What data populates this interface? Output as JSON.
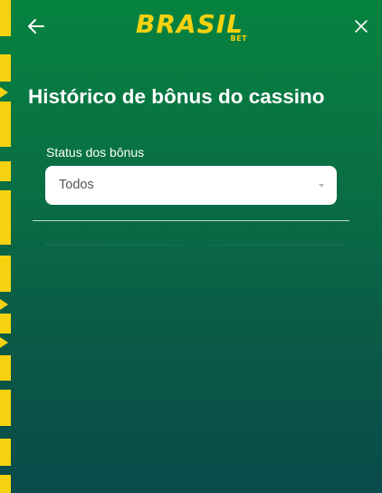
{
  "header": {
    "logo_main": "BRASIL",
    "logo_sub": "BET",
    "back_icon": "arrow-left-icon",
    "close_icon": "close-icon"
  },
  "page": {
    "title": "Histórico de bônus do cassino"
  },
  "filter": {
    "label": "Status dos bônus",
    "selected": "Todos"
  },
  "colors": {
    "brand_yellow": "#f5d20f",
    "background_top": "#06833f",
    "background_bottom": "#0a4b4b"
  }
}
